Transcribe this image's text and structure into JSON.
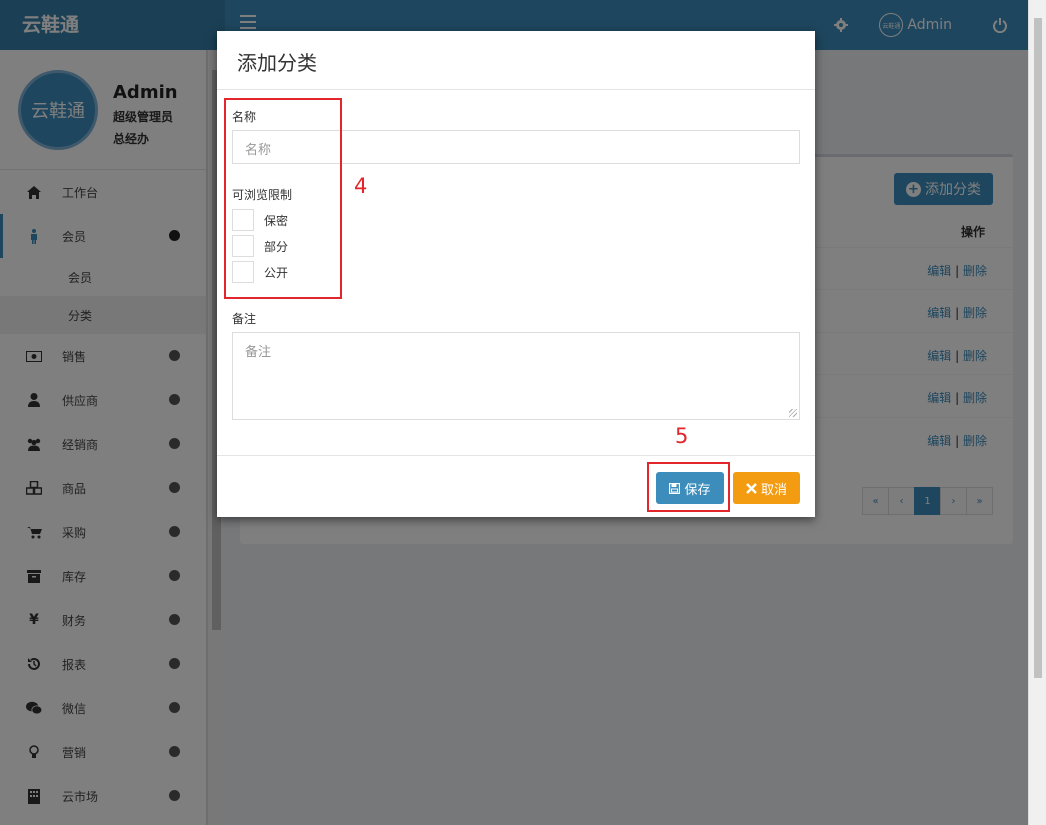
{
  "app": {
    "brand": "云鞋通"
  },
  "topbar": {
    "avatar_text": "云鞋通",
    "user_name": "Admin"
  },
  "user_panel": {
    "avatar_text": "云鞋通",
    "name": "Admin",
    "role": "超级管理员",
    "dept": "总经办"
  },
  "sidebar": {
    "items": [
      {
        "label": "工作台",
        "icon": "home-icon"
      },
      {
        "label": "会员",
        "icon": "person-icon"
      },
      {
        "label": "销售",
        "icon": "money-icon"
      },
      {
        "label": "供应商",
        "icon": "user-icon"
      },
      {
        "label": "经销商",
        "icon": "users-icon"
      },
      {
        "label": "商品",
        "icon": "cubes-icon"
      },
      {
        "label": "采购",
        "icon": "cart-icon"
      },
      {
        "label": "库存",
        "icon": "archive-icon"
      },
      {
        "label": "财务",
        "icon": "yen-icon"
      },
      {
        "label": "报表",
        "icon": "history-icon"
      },
      {
        "label": "微信",
        "icon": "wechat-icon"
      },
      {
        "label": "营销",
        "icon": "bulb-icon"
      },
      {
        "label": "云市场",
        "icon": "building-icon"
      }
    ],
    "submenu": [
      {
        "label": "会员"
      },
      {
        "label": "分类"
      }
    ]
  },
  "content": {
    "add_button": "添加分类",
    "col_ops": "操作",
    "row_edit": "编辑",
    "row_sep": "|",
    "row_delete": "删除",
    "pager": [
      "«",
      "‹",
      "1",
      "›",
      "»"
    ]
  },
  "modal": {
    "title": "添加分类",
    "name_label": "名称",
    "name_placeholder": "名称",
    "limit_label": "可浏览限制",
    "options": [
      "保密",
      "部分",
      "公开"
    ],
    "note_label": "备注",
    "note_placeholder": "备注",
    "save": "保存",
    "cancel": "取消"
  },
  "annotations": {
    "step4": "4",
    "step5": "5"
  },
  "colors": {
    "primary": "#3c8dbc",
    "warning": "#f39c12",
    "annotation": "#e3262b"
  }
}
